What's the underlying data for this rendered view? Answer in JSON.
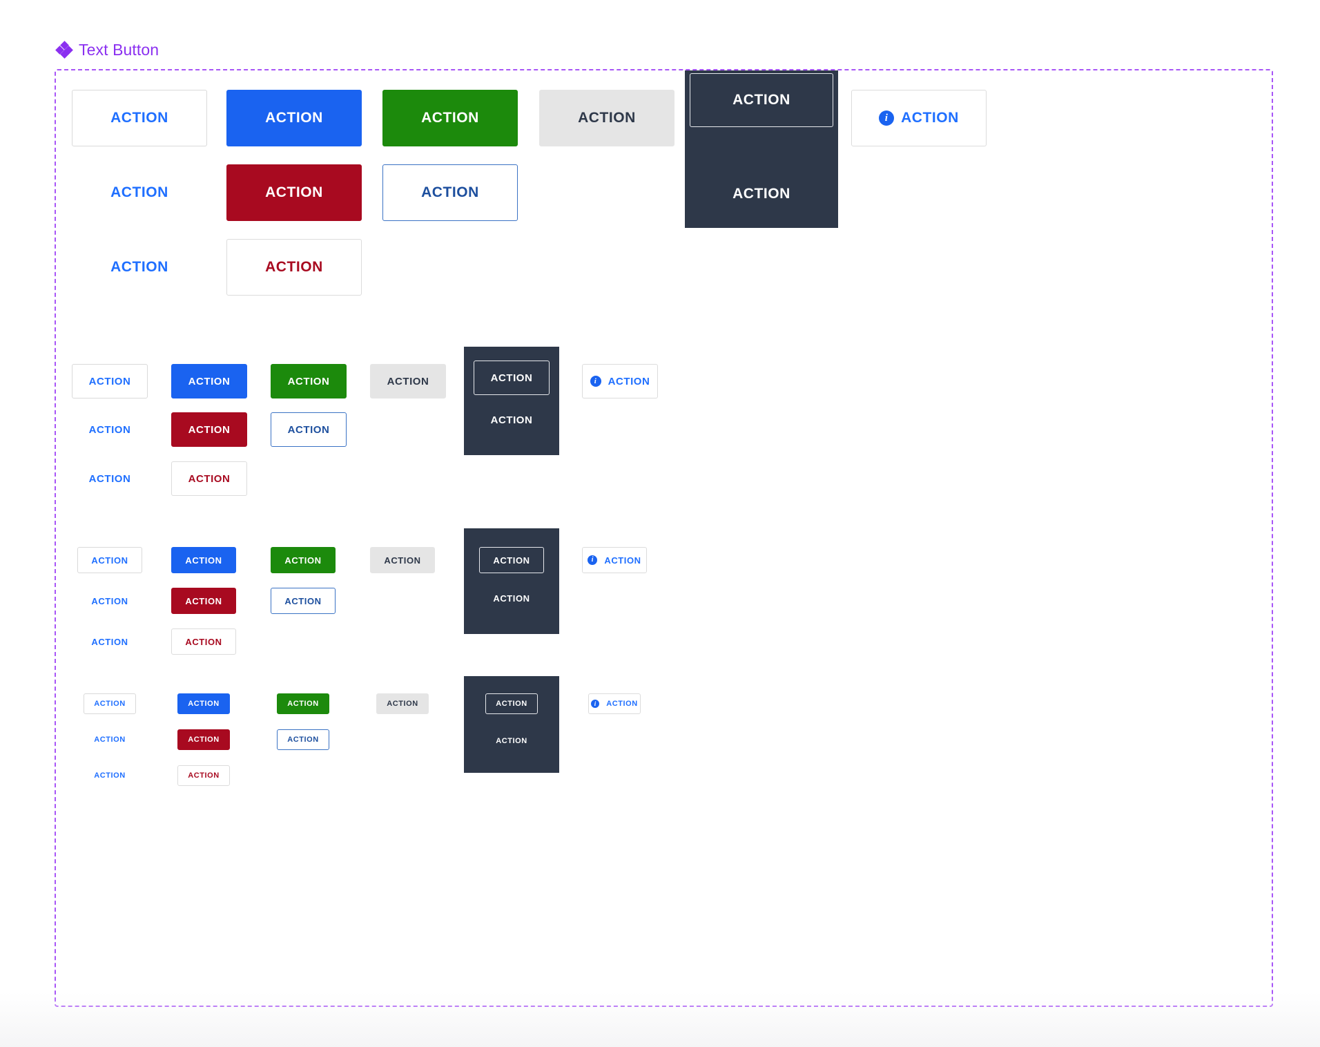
{
  "header": {
    "title": "Text Button",
    "icon": "diamond-cluster-icon",
    "color": "#8b30f0"
  },
  "colors": {
    "accent_purple": "#8b30f0",
    "primary_blue": "#1a63f0",
    "success_green": "#1c8a0c",
    "danger_red": "#a80a20",
    "disabled_gray": "#e5e5e5",
    "dark_surface": "#2e3849",
    "border_gray": "#d9d9d9",
    "link_blue": "#1f6fff"
  },
  "button_label": "ACTION",
  "icons": {
    "info": "info-icon"
  },
  "groups": [
    {
      "name": "extra-large",
      "size": "xl",
      "buttons": [
        {
          "variant": "outline-gray",
          "label": "ACTION",
          "row": 1,
          "col": 1,
          "icon": null
        },
        {
          "variant": "primary",
          "label": "ACTION",
          "row": 1,
          "col": 2,
          "icon": null
        },
        {
          "variant": "success",
          "label": "ACTION",
          "row": 1,
          "col": 3,
          "icon": null
        },
        {
          "variant": "disabled",
          "label": "ACTION",
          "row": 1,
          "col": 4,
          "icon": null
        },
        {
          "variant": "on-dark-outline",
          "label": "ACTION",
          "row": 1,
          "col": 5,
          "icon": null
        },
        {
          "variant": "info-outline",
          "label": "ACTION",
          "row": 1,
          "col": 6,
          "icon": "info-icon"
        },
        {
          "variant": "text",
          "label": "ACTION",
          "row": 2,
          "col": 1,
          "icon": null
        },
        {
          "variant": "danger",
          "label": "ACTION",
          "row": 2,
          "col": 2,
          "icon": null
        },
        {
          "variant": "outline-blue",
          "label": "ACTION",
          "row": 2,
          "col": 3,
          "icon": null
        },
        {
          "variant": "on-dark-text",
          "label": "ACTION",
          "row": 2,
          "col": 5,
          "icon": null
        },
        {
          "variant": "text",
          "label": "ACTION",
          "row": 3,
          "col": 1,
          "icon": null
        },
        {
          "variant": "danger-text",
          "label": "ACTION",
          "row": 3,
          "col": 2,
          "icon": null
        }
      ]
    },
    {
      "name": "large",
      "size": "lg",
      "buttons": [
        {
          "variant": "outline-gray",
          "label": "ACTION",
          "row": 1,
          "col": 1,
          "icon": null
        },
        {
          "variant": "primary",
          "label": "ACTION",
          "row": 1,
          "col": 2,
          "icon": null
        },
        {
          "variant": "success",
          "label": "ACTION",
          "row": 1,
          "col": 3,
          "icon": null
        },
        {
          "variant": "disabled",
          "label": "ACTION",
          "row": 1,
          "col": 4,
          "icon": null
        },
        {
          "variant": "on-dark-outline",
          "label": "ACTION",
          "row": 1,
          "col": 5,
          "icon": null
        },
        {
          "variant": "info-outline",
          "label": "ACTION",
          "row": 1,
          "col": 6,
          "icon": "info-icon"
        },
        {
          "variant": "text",
          "label": "ACTION",
          "row": 2,
          "col": 1,
          "icon": null
        },
        {
          "variant": "danger",
          "label": "ACTION",
          "row": 2,
          "col": 2,
          "icon": null
        },
        {
          "variant": "outline-blue",
          "label": "ACTION",
          "row": 2,
          "col": 3,
          "icon": null
        },
        {
          "variant": "on-dark-text",
          "label": "ACTION",
          "row": 2,
          "col": 5,
          "icon": null
        },
        {
          "variant": "text",
          "label": "ACTION",
          "row": 3,
          "col": 1,
          "icon": null
        },
        {
          "variant": "danger-text",
          "label": "ACTION",
          "row": 3,
          "col": 2,
          "icon": null
        }
      ]
    },
    {
      "name": "medium",
      "size": "md",
      "buttons": [
        {
          "variant": "outline-gray",
          "label": "ACTION",
          "row": 1,
          "col": 1,
          "icon": null
        },
        {
          "variant": "primary",
          "label": "ACTION",
          "row": 1,
          "col": 2,
          "icon": null
        },
        {
          "variant": "success",
          "label": "ACTION",
          "row": 1,
          "col": 3,
          "icon": null
        },
        {
          "variant": "disabled",
          "label": "ACTION",
          "row": 1,
          "col": 4,
          "icon": null
        },
        {
          "variant": "on-dark-outline",
          "label": "ACTION",
          "row": 1,
          "col": 5,
          "icon": null
        },
        {
          "variant": "info-outline",
          "label": "ACTION",
          "row": 1,
          "col": 6,
          "icon": "info-icon"
        },
        {
          "variant": "text",
          "label": "ACTION",
          "row": 2,
          "col": 1,
          "icon": null
        },
        {
          "variant": "danger",
          "label": "ACTION",
          "row": 2,
          "col": 2,
          "icon": null
        },
        {
          "variant": "outline-blue",
          "label": "ACTION",
          "row": 2,
          "col": 3,
          "icon": null
        },
        {
          "variant": "on-dark-text",
          "label": "ACTION",
          "row": 2,
          "col": 5,
          "icon": null
        },
        {
          "variant": "text",
          "label": "ACTION",
          "row": 3,
          "col": 1,
          "icon": null
        },
        {
          "variant": "danger-text",
          "label": "ACTION",
          "row": 3,
          "col": 2,
          "icon": null
        }
      ]
    },
    {
      "name": "small",
      "size": "sm",
      "buttons": [
        {
          "variant": "outline-gray",
          "label": "ACTION",
          "row": 1,
          "col": 1,
          "icon": null
        },
        {
          "variant": "primary",
          "label": "ACTION",
          "row": 1,
          "col": 2,
          "icon": null
        },
        {
          "variant": "success",
          "label": "ACTION",
          "row": 1,
          "col": 3,
          "icon": null
        },
        {
          "variant": "disabled",
          "label": "ACTION",
          "row": 1,
          "col": 4,
          "icon": null
        },
        {
          "variant": "on-dark-outline",
          "label": "ACTION",
          "row": 1,
          "col": 5,
          "icon": null
        },
        {
          "variant": "info-outline",
          "label": "ACTION",
          "row": 1,
          "col": 6,
          "icon": "info-icon"
        },
        {
          "variant": "text",
          "label": "ACTION",
          "row": 2,
          "col": 1,
          "icon": null
        },
        {
          "variant": "danger",
          "label": "ACTION",
          "row": 2,
          "col": 2,
          "icon": null
        },
        {
          "variant": "outline-blue",
          "label": "ACTION",
          "row": 2,
          "col": 3,
          "icon": null
        },
        {
          "variant": "on-dark-text",
          "label": "ACTION",
          "row": 2,
          "col": 5,
          "icon": null
        },
        {
          "variant": "text",
          "label": "ACTION",
          "row": 3,
          "col": 1,
          "icon": null
        },
        {
          "variant": "danger-text",
          "label": "ACTION",
          "row": 3,
          "col": 2,
          "icon": null
        }
      ]
    }
  ]
}
